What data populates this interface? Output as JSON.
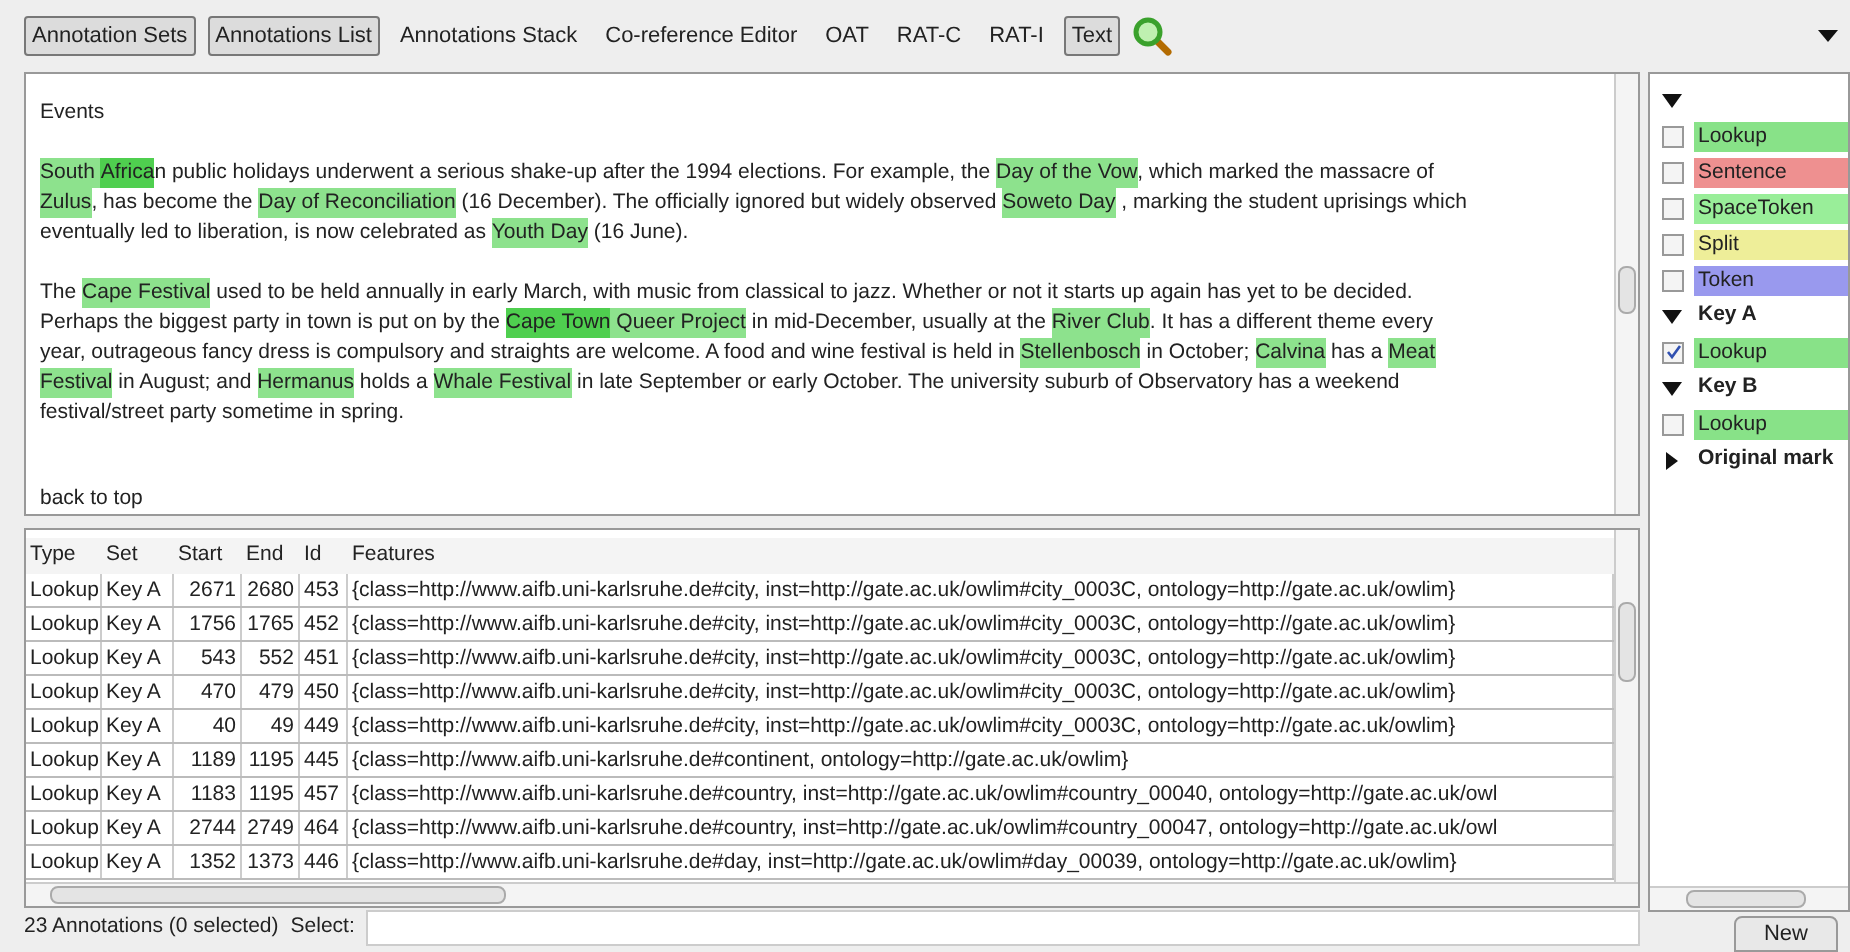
{
  "toolbar": [
    {
      "label": "Annotation Sets",
      "selected": true
    },
    {
      "label": "Annotations List",
      "selected": true
    },
    {
      "label": "Annotations Stack",
      "selected": false
    },
    {
      "label": "Co-reference Editor",
      "selected": false
    },
    {
      "label": "OAT",
      "selected": false
    },
    {
      "label": "RAT-C",
      "selected": false
    },
    {
      "label": "RAT-I",
      "selected": false
    },
    {
      "label": "Text",
      "selected": true
    }
  ],
  "document": {
    "heading": "Events",
    "paragraphs": [
      [
        [
          {
            "text": "South ",
            "color": "#8de28d"
          },
          {
            "text": "Africa",
            "color": "#4fcf4f"
          },
          {
            "text": "n public holidays underwent a serious shake-up after the 1994 elections. For example, the "
          },
          {
            "text": "Day of the Vow",
            "color": "#8de28d"
          },
          {
            "text": ", which marked the massacre of"
          }
        ],
        [
          {
            "text": "Zulus",
            "color": "#8de28d"
          },
          {
            "text": ", has become the "
          },
          {
            "text": "Day of Reconciliation",
            "color": "#8de28d"
          },
          {
            "text": " (16 December). The officially ignored but widely observed "
          },
          {
            "text": "Soweto Day",
            "color": "#8de28d"
          },
          {
            "text": " , marking the student uprisings which"
          }
        ],
        [
          {
            "text": "eventually led to liberation, is now celebrated as "
          },
          {
            "text": "Youth Day",
            "color": "#8de28d"
          },
          {
            "text": " (16 June)."
          }
        ]
      ],
      [
        [
          {
            "text": "The "
          },
          {
            "text": "Cape Festival",
            "color": "#8de28d"
          },
          {
            "text": " used to be held annually in early March, with music from classical to jazz. Whether or not it starts up again has yet to be decided."
          }
        ],
        [
          {
            "text": "Perhaps the biggest party in town is put on by the "
          },
          {
            "text": "Cape Town",
            "color": "#4fcf4f"
          },
          {
            "text": " Queer Project",
            "color": "#8de28d"
          },
          {
            "text": " in mid-December, usually at the "
          },
          {
            "text": "River Club",
            "color": "#8de28d"
          },
          {
            "text": ". It has a different theme every"
          }
        ],
        [
          {
            "text": "year, outrageous fancy dress is compulsory and straights are welcome. A food and wine festival is held in "
          },
          {
            "text": "Stellenbosch",
            "color": "#8de28d"
          },
          {
            "text": " in October; "
          },
          {
            "text": "Calvina",
            "color": "#8de28d"
          },
          {
            "text": " has a "
          },
          {
            "text": "Meat",
            "color": "#8de28d"
          }
        ],
        [
          {
            "text": "Festival",
            "color": "#8de28d"
          },
          {
            "text": " in August; and "
          },
          {
            "text": "Hermanus",
            "color": "#8de28d"
          },
          {
            "text": " holds a "
          },
          {
            "text": "Whale Festival",
            "color": "#8de28d"
          },
          {
            "text": " in late September or early October. The university suburb of Observatory has a weekend"
          }
        ],
        [
          {
            "text": "festival/street party sometime in spring."
          }
        ]
      ]
    ],
    "link": "back to top"
  },
  "table": {
    "columns": [
      "Type",
      "Set",
      "Start",
      "End",
      "Id",
      "Features"
    ],
    "rows": [
      [
        "Lookup",
        "Key A",
        "2671",
        "2680",
        "453",
        "{class=http://www.aifb.uni-karlsruhe.de#city, inst=http://gate.ac.uk/owlim#city_0003C, ontology=http://gate.ac.uk/owlim}"
      ],
      [
        "Lookup",
        "Key A",
        "1756",
        "1765",
        "452",
        "{class=http://www.aifb.uni-karlsruhe.de#city, inst=http://gate.ac.uk/owlim#city_0003C, ontology=http://gate.ac.uk/owlim}"
      ],
      [
        "Lookup",
        "Key A",
        "543",
        "552",
        "451",
        "{class=http://www.aifb.uni-karlsruhe.de#city, inst=http://gate.ac.uk/owlim#city_0003C, ontology=http://gate.ac.uk/owlim}"
      ],
      [
        "Lookup",
        "Key A",
        "470",
        "479",
        "450",
        "{class=http://www.aifb.uni-karlsruhe.de#city, inst=http://gate.ac.uk/owlim#city_0003C, ontology=http://gate.ac.uk/owlim}"
      ],
      [
        "Lookup",
        "Key A",
        "40",
        "49",
        "449",
        "{class=http://www.aifb.uni-karlsruhe.de#city, inst=http://gate.ac.uk/owlim#city_0003C, ontology=http://gate.ac.uk/owlim}"
      ],
      [
        "Lookup",
        "Key A",
        "1189",
        "1195",
        "445",
        "{class=http://www.aifb.uni-karlsruhe.de#continent, ontology=http://gate.ac.uk/owlim}"
      ],
      [
        "Lookup",
        "Key A",
        "1183",
        "1195",
        "457",
        "{class=http://www.aifb.uni-karlsruhe.de#country, inst=http://gate.ac.uk/owlim#country_00040, ontology=http://gate.ac.uk/owl"
      ],
      [
        "Lookup",
        "Key A",
        "2744",
        "2749",
        "464",
        "{class=http://www.aifb.uni-karlsruhe.de#country, inst=http://gate.ac.uk/owlim#country_00047, ontology=http://gate.ac.uk/owl"
      ],
      [
        "Lookup",
        "Key A",
        "1352",
        "1373",
        "446",
        "{class=http://www.aifb.uni-karlsruhe.de#day, inst=http://gate.ac.uk/owlim#day_00039, ontology=http://gate.ac.uk/owlim}"
      ]
    ]
  },
  "status_bar": {
    "count": "23 Annotations (0 selected)",
    "select_label": "Select:"
  },
  "annotation_sets": [
    {
      "expanded": true,
      "items": [
        {
          "label": "Lookup",
          "checked": false,
          "color": "#88e288"
        },
        {
          "label": "Sentence",
          "checked": false,
          "color": "#ee9090"
        },
        {
          "label": "SpaceToken",
          "checked": false,
          "color": "#99ee99"
        },
        {
          "label": "Split",
          "checked": false,
          "color": "#eeee99"
        },
        {
          "label": "Token",
          "checked": false,
          "color": "#9999ee"
        }
      ]
    },
    {
      "name": "Key A",
      "expanded": true,
      "items": [
        {
          "label": "Lookup",
          "checked": true,
          "color": "#88e288"
        }
      ]
    },
    {
      "name": "Key B",
      "expanded": true,
      "items": [
        {
          "label": "Lookup",
          "checked": false,
          "color": "#88e288"
        }
      ]
    },
    {
      "name": "Original mark",
      "expanded": false
    }
  ],
  "new_button": "New"
}
